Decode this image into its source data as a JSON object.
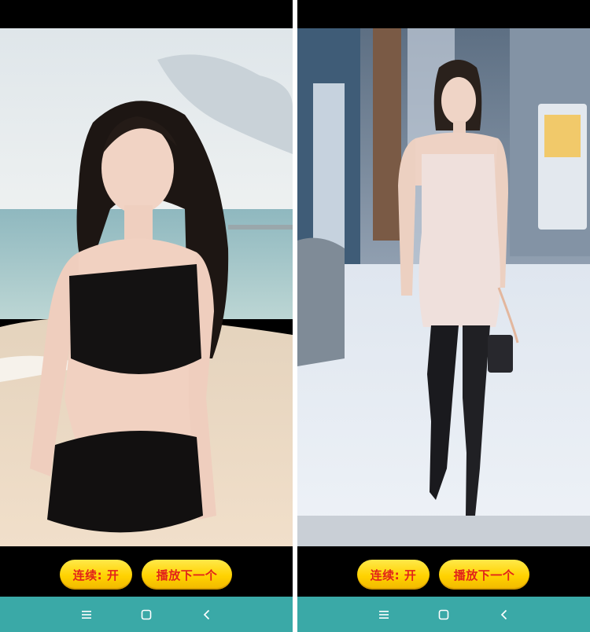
{
  "screens": [
    {
      "id": "left",
      "video": {
        "icon": "video-frame-beach"
      },
      "controls": {
        "continuous_label": "连续: 开",
        "next_label": "播放下一个"
      },
      "navbar": {
        "menu_icon": "menu-icon",
        "home_icon": "home-icon",
        "back_icon": "back-icon"
      }
    },
    {
      "id": "right",
      "video": {
        "icon": "video-frame-street"
      },
      "controls": {
        "continuous_label": "连续: 开",
        "next_label": "播放下一个"
      },
      "navbar": {
        "menu_icon": "menu-icon",
        "home_icon": "home-icon",
        "back_icon": "back-icon"
      }
    }
  ],
  "colors": {
    "button_fill": "#ffd200",
    "button_text": "#e2231a",
    "navbar": "#3aa9a7",
    "background": "#000000"
  }
}
